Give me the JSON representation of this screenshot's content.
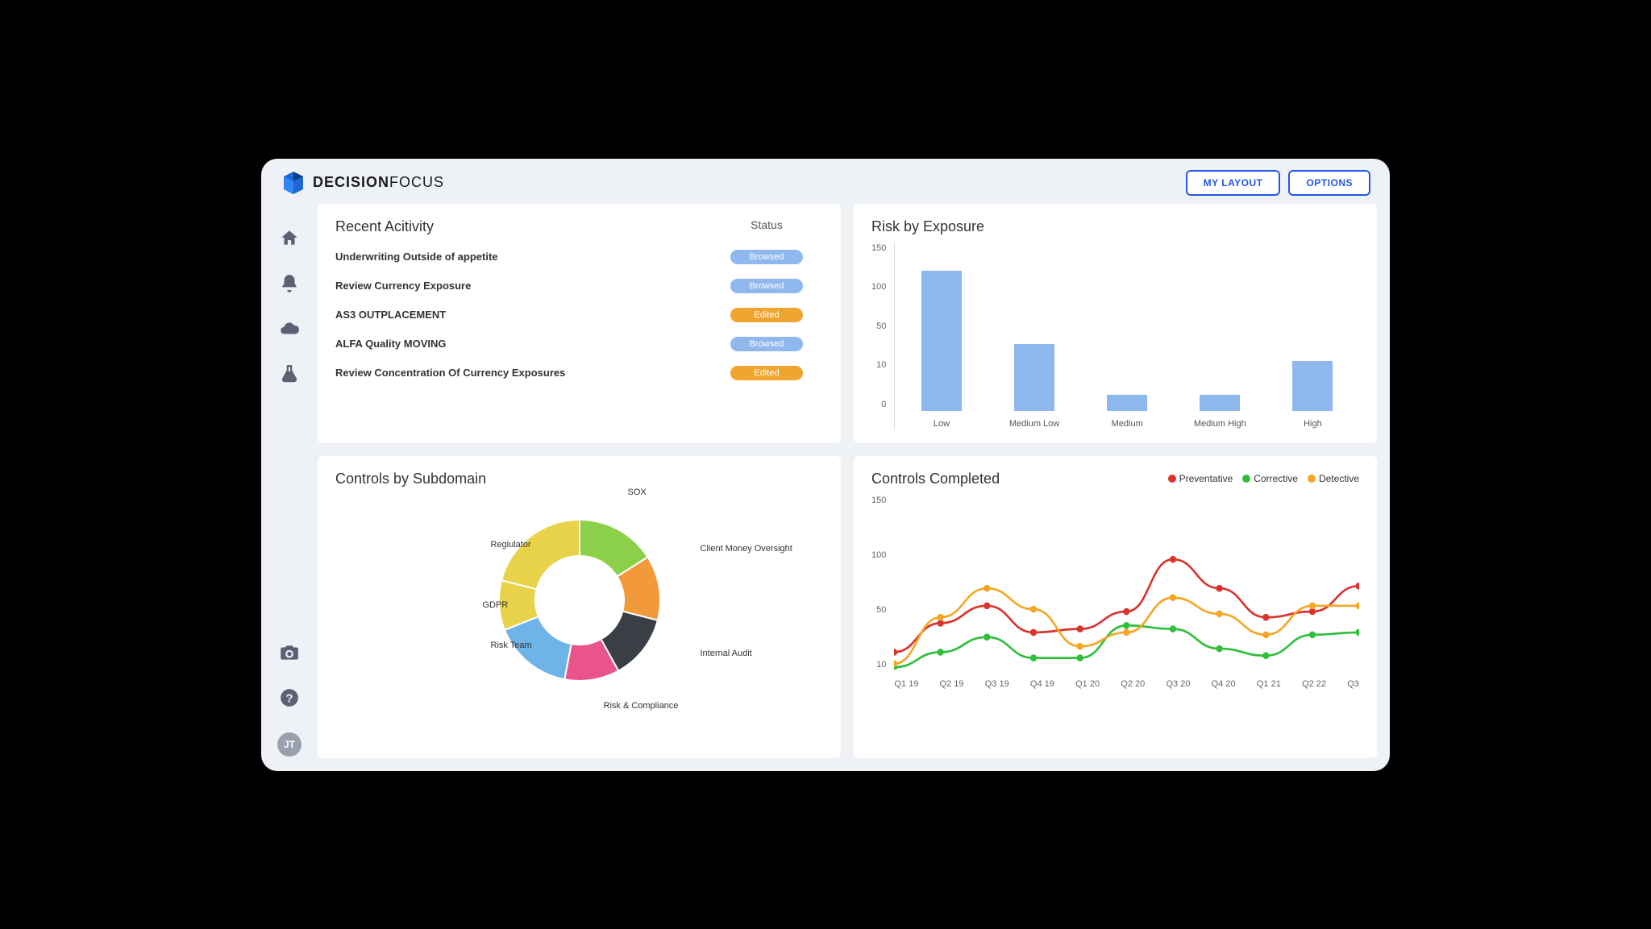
{
  "brand": {
    "bold": "DECISION",
    "light": "FOCUS"
  },
  "header": {
    "my_layout": "MY LAYOUT",
    "options": "OPTIONS"
  },
  "sidebar": {
    "avatar": "JT"
  },
  "recent": {
    "title": "Recent Acitivity",
    "status_header": "Status",
    "items": [
      {
        "label": "Underwriting Outside of appetite",
        "status": "Browsed",
        "kind": "browsed"
      },
      {
        "label": "Review Currency Exposure",
        "status": "Browsed",
        "kind": "browsed"
      },
      {
        "label": "AS3 OUTPLACEMENT",
        "status": "Edited",
        "kind": "edited"
      },
      {
        "label": "ALFA Quality MOVING",
        "status": "Browsed",
        "kind": "browsed"
      },
      {
        "label": "Review Concentration Of Currency Exposures",
        "status": "Edited",
        "kind": "edited"
      }
    ]
  },
  "controls_sub": {
    "title": "Controls by Subdomain",
    "slices": [
      {
        "label": "SOX",
        "color": "#8cd04a"
      },
      {
        "label": "Client Money Oversight",
        "color": "#f29a3a"
      },
      {
        "label": "Internal Audit",
        "color": "#3a3f46"
      },
      {
        "label": "Risk & Compliance",
        "color": "#e9548a"
      },
      {
        "label": "Risk Team",
        "color": "#6fb4e8"
      },
      {
        "label": "GDPR",
        "color": "#e8d24a"
      },
      {
        "label": "Regiulator",
        "color": "#e8d24a"
      }
    ]
  },
  "risk": {
    "title": "Risk by Exposure",
    "y_ticks": [
      "150",
      "100",
      "50",
      "10",
      "0"
    ]
  },
  "completed": {
    "title": "Controls Completed",
    "legend": [
      {
        "label": "Preventative",
        "color": "#d9342b"
      },
      {
        "label": "Corrective",
        "color": "#2fbf3a"
      },
      {
        "label": "Detective",
        "color": "#f5a623"
      }
    ],
    "y_ticks": [
      "150",
      "100",
      "50",
      "10"
    ]
  },
  "chart_data": [
    {
      "type": "bar",
      "title": "Risk by Exposure",
      "categories": [
        "Low",
        "Medium Low",
        "Medium",
        "Medium High",
        "High"
      ],
      "values": [
        130,
        62,
        15,
        15,
        46
      ],
      "ylim": [
        0,
        150
      ],
      "y_ticks": [
        0,
        10,
        50,
        100,
        150
      ]
    },
    {
      "type": "pie",
      "title": "Controls by Subdomain",
      "categories": [
        "SOX",
        "Client Money Oversight",
        "Internal Audit",
        "Risk & Compliance",
        "Risk Team",
        "GDPR",
        "Regiulator"
      ],
      "values": [
        16,
        13,
        13,
        11,
        16,
        10,
        21
      ],
      "colors": [
        "#8cd04a",
        "#f29a3a",
        "#3a3f46",
        "#e9548a",
        "#6fb4e8",
        "#e8d24a",
        "#e8d24a"
      ]
    },
    {
      "type": "line",
      "title": "Controls Completed",
      "x": [
        "Q1 19",
        "Q2 19",
        "Q3 19",
        "Q4 19",
        "Q1 20",
        "Q2 20",
        "Q3 20",
        "Q4 20",
        "Q1 21",
        "Q2 22",
        "Q3"
      ],
      "series": [
        {
          "name": "Preventative",
          "color": "#d9342b",
          "values": [
            15,
            40,
            55,
            32,
            35,
            50,
            95,
            70,
            45,
            50,
            72
          ]
        },
        {
          "name": "Corrective",
          "color": "#2fbf3a",
          "values": [
            2,
            15,
            28,
            10,
            10,
            38,
            35,
            18,
            12,
            30,
            32
          ]
        },
        {
          "name": "Detective",
          "color": "#f5a623",
          "values": [
            5,
            45,
            70,
            52,
            20,
            32,
            62,
            48,
            30,
            55,
            55
          ]
        }
      ],
      "ylim": [
        0,
        150
      ],
      "y_ticks": [
        10,
        50,
        100,
        150
      ]
    }
  ]
}
